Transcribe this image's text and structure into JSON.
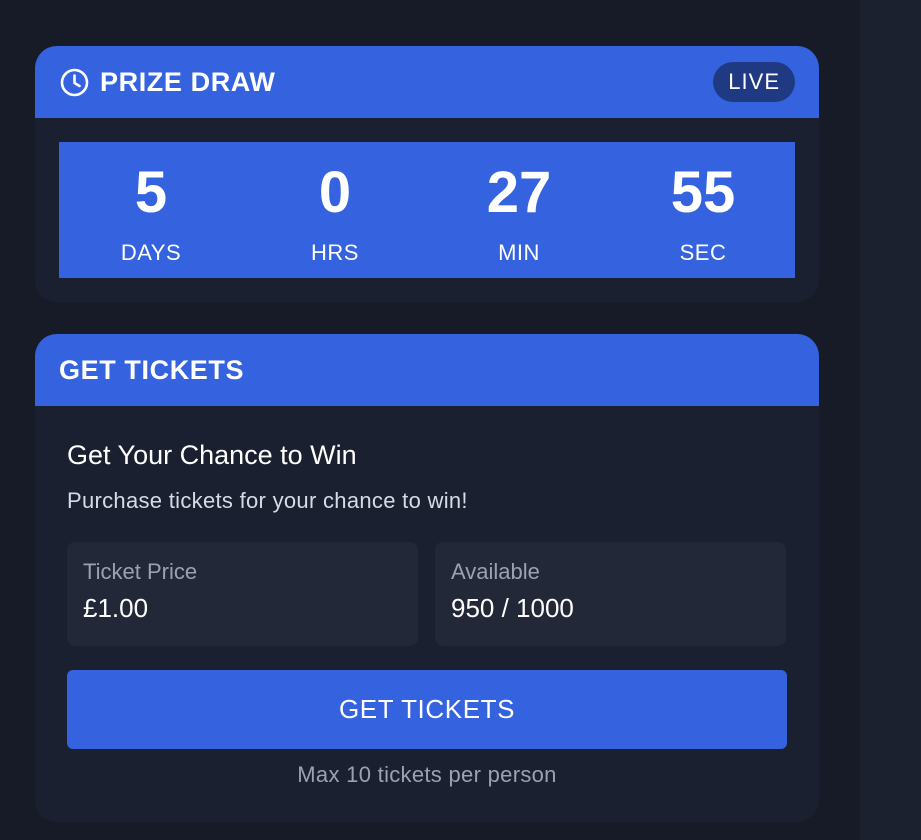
{
  "draw_card": {
    "title": "PRIZE DRAW",
    "clock_icon": "clock-icon",
    "status_badge": "LIVE",
    "countdown": [
      {
        "value": "5",
        "label": "DAYS"
      },
      {
        "value": "0",
        "label": "HRS"
      },
      {
        "value": "27",
        "label": "MIN"
      },
      {
        "value": "55",
        "label": "SEC"
      }
    ]
  },
  "tickets_card": {
    "title": "GET TICKETS",
    "headline": "Get Your Chance to Win",
    "subline": "Purchase tickets for your chance to win!",
    "price": {
      "label": "Ticket Price",
      "value": "£1.00"
    },
    "available": {
      "label": "Available",
      "value": "950 / 1000"
    },
    "button_label": "GET TICKETS",
    "limit_note": "Max 10 tickets per person"
  },
  "colors": {
    "accent": "#3563e0",
    "background": "#171b27",
    "card": "#1b2030",
    "badge": "#1f3a82"
  }
}
